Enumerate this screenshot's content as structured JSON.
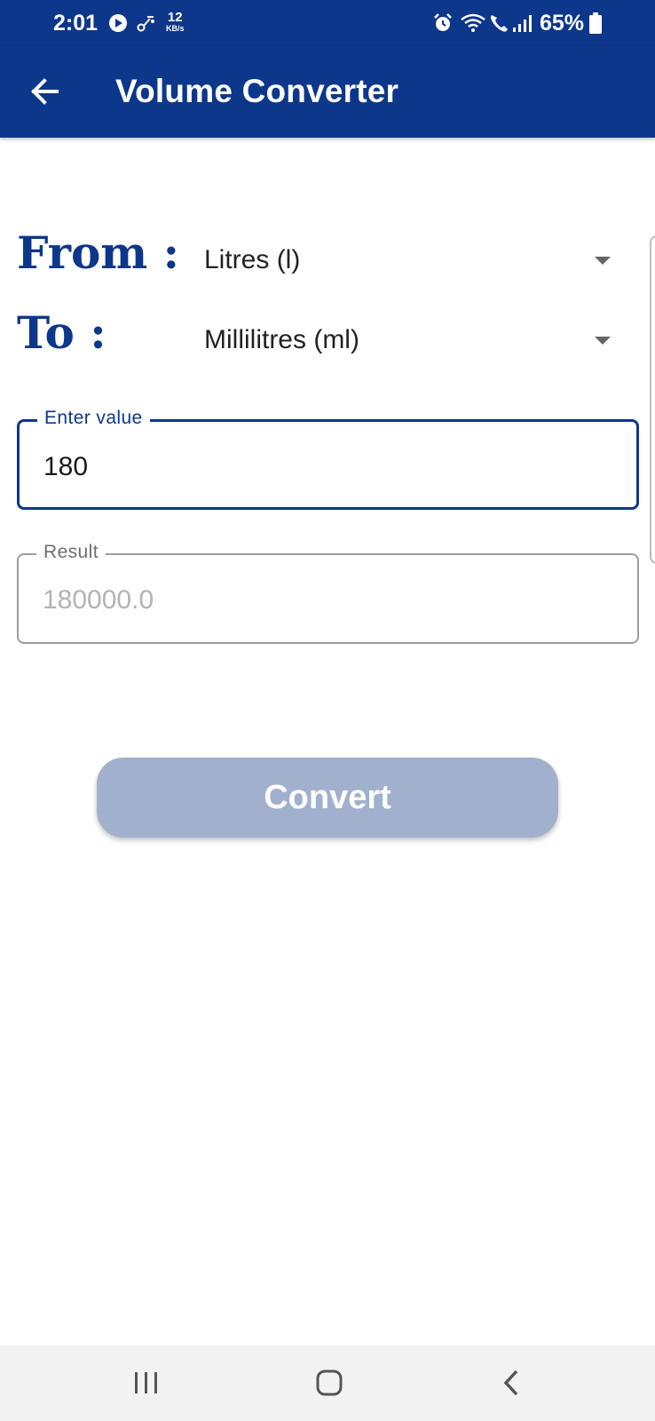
{
  "status_bar": {
    "time": "2:01",
    "network_speed_value": "12",
    "network_speed_unit": "KB/s",
    "battery_percent": "65%",
    "icons": [
      "media-play-icon",
      "link-icon",
      "alarm-icon",
      "wifi-icon",
      "wifi-call-icon",
      "signal-icon",
      "battery-icon"
    ]
  },
  "app_bar": {
    "title": "Volume Converter",
    "back_icon": "arrow-left-icon"
  },
  "from": {
    "label": "From :",
    "selected": "Litres (l)"
  },
  "to": {
    "label": "To :",
    "selected": "Millilitres (ml)"
  },
  "input": {
    "label": "Enter value",
    "value": "180"
  },
  "result": {
    "label": "Result",
    "value": "180000.0"
  },
  "convert_button": {
    "label": "Convert"
  },
  "nav_bar": {
    "icons": [
      "recent-apps-icon",
      "home-icon",
      "back-icon"
    ]
  },
  "colors": {
    "primary": "#0d378a",
    "button_disabled": "#a1b1cd",
    "result_text": "#b3b3b3",
    "nav_background": "#f2f2f2"
  }
}
